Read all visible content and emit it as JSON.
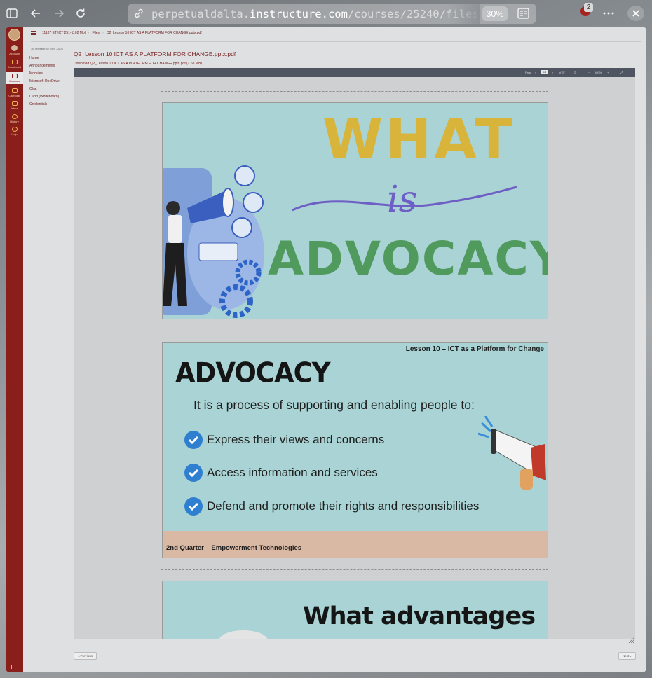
{
  "browser": {
    "url_prefix": "perpetualdalta.",
    "url_host": "instructure.com",
    "url_path": "/courses/25240/files",
    "zoom": "30%",
    "extension_count": "2"
  },
  "canvas": {
    "global_nav": [
      {
        "label": "Account"
      },
      {
        "label": "Dashboard"
      },
      {
        "label": "Courses"
      },
      {
        "label": "Calendar"
      },
      {
        "label": "Inbox"
      },
      {
        "label": "History"
      },
      {
        "label": "Help"
      }
    ],
    "breadcrumbs": [
      "11107 ET ICT 251-1102 Mol",
      "Files",
      "Q2_Lesson 10 ICT AS A PLATFORM FOR CHANGE.pptx.pdf"
    ],
    "term": "1st Semester SY 2025 - 2026",
    "course_nav": [
      "Home",
      "Announcements",
      "Modules",
      "Microsoft OneDrive",
      "Chat",
      "Lucid (Whiteboard)",
      "Credentials"
    ],
    "file_title": "Q2_Lesson 10 ICT AS A PLATFORM FOR CHANGE.pptx.pdf",
    "download_link": "Download Q2_Lesson 10 ICT AS A PLATFORM FOR CHANGE.pptx.pdf (2.68 MB)",
    "viewer": {
      "page_label": "Page",
      "page_value": "16",
      "page_total": "of 37",
      "zoom_value": "100%"
    },
    "prev_button": "◂ Previous",
    "next_button": "Next ▸"
  },
  "slides": {
    "s1_word1": "WHAT",
    "s1_word2": "is",
    "s1_word3": "ADVOCACY?",
    "s2_header": "Lesson 10 – ICT as a Platform for Change",
    "s2_title": "ADVOCACY",
    "s2_sub": "It is a process of supporting and enabling people to:",
    "s2_bullets": [
      "Express their views and concerns",
      "Access information and services",
      "Defend and promote their rights and responsibilities"
    ],
    "s2_footer": "2nd Quarter – Empowerment Technologies",
    "s3_title": "What advantages"
  },
  "colors": {
    "canvas_red": "#8a1e1a",
    "slide_bg": "#a9d3d4",
    "what_yellow": "#d8b43a",
    "is_purple": "#6e5fc6",
    "advocacy_green": "#4f9a5c",
    "check_blue": "#2f7fd0"
  }
}
